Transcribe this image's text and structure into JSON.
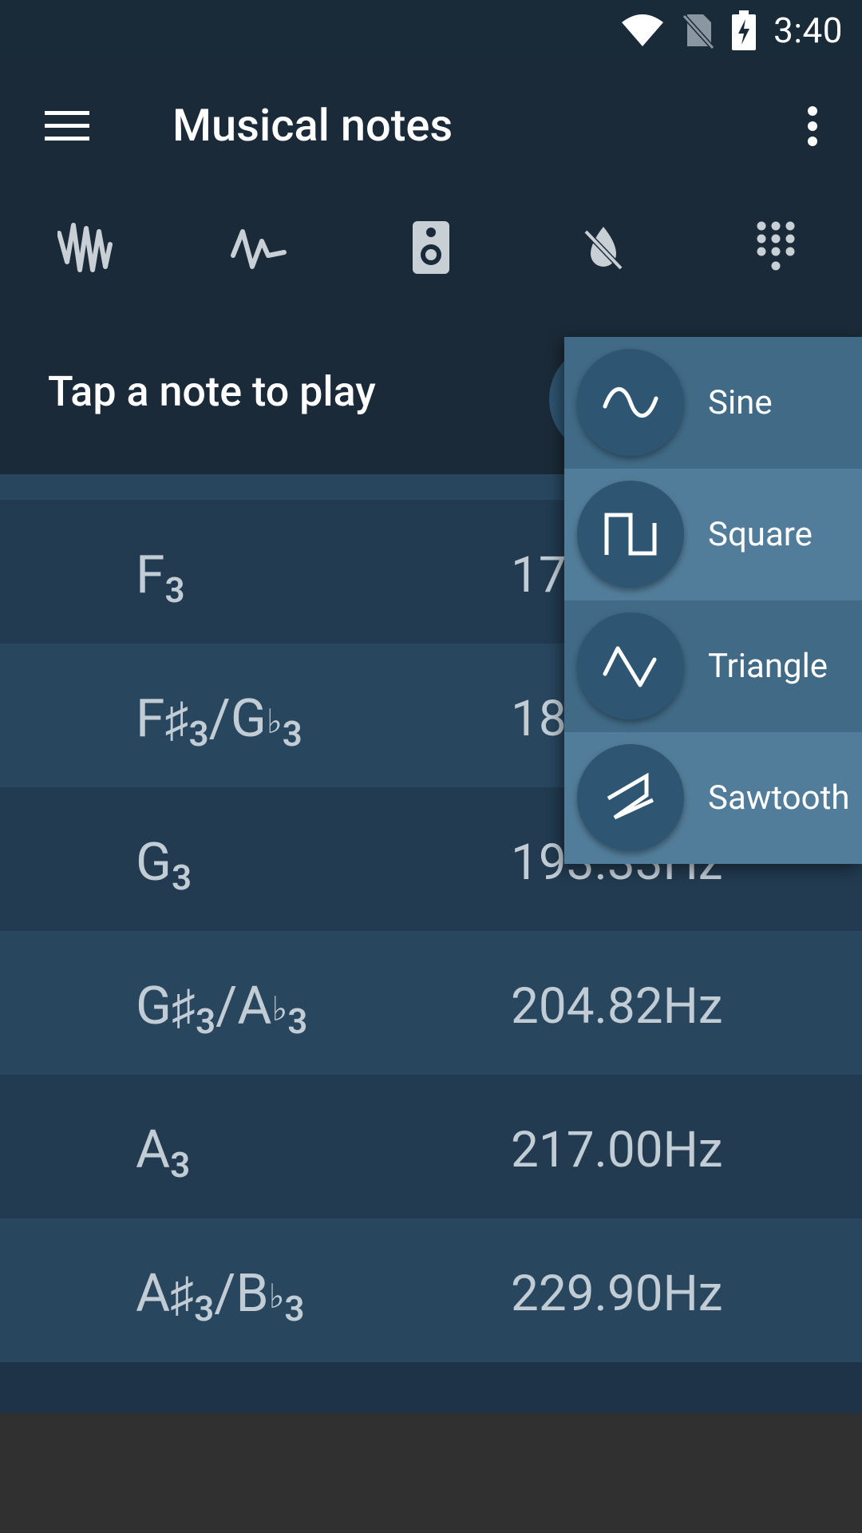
{
  "status": {
    "time": "3:40"
  },
  "app": {
    "title": "Musical notes"
  },
  "toolbar": {
    "items": [
      {
        "icon": "noise-wave-icon"
      },
      {
        "icon": "waveform-icon"
      },
      {
        "icon": "speaker-icon"
      },
      {
        "icon": "mute-drop-icon"
      },
      {
        "icon": "dialpad-icon"
      }
    ]
  },
  "tap_bar": {
    "label": "Tap a note to play"
  },
  "notes": [
    {
      "letter": "F",
      "octave": "3",
      "alt_letter": "",
      "alt_octave": "",
      "freq": "17"
    },
    {
      "letter": "F",
      "octave": "3",
      "alt_letter": "G",
      "alt_octave": "3",
      "freq": "18"
    },
    {
      "letter": "G",
      "octave": "3",
      "alt_letter": "",
      "alt_octave": "",
      "freq": "193.33Hz"
    },
    {
      "letter": "G",
      "octave": "3",
      "alt_letter": "A",
      "alt_octave": "3",
      "freq": "204.82Hz"
    },
    {
      "letter": "A",
      "octave": "3",
      "alt_letter": "",
      "alt_octave": "",
      "freq": "217.00Hz"
    },
    {
      "letter": "A",
      "octave": "3",
      "alt_letter": "B",
      "alt_octave": "3",
      "freq": "229.90Hz"
    }
  ],
  "symbols": {
    "sharp": "♯",
    "flat": "♭",
    "slash": "/"
  },
  "wave_menu": {
    "items": [
      {
        "label": "Sine",
        "icon": "sine-wave-icon"
      },
      {
        "label": "Square",
        "icon": "square-wave-icon"
      },
      {
        "label": "Triangle",
        "icon": "triangle-wave-icon"
      },
      {
        "label": "Sawtooth",
        "icon": "sawtooth-wave-icon"
      }
    ]
  },
  "colors": {
    "app_bar": "#1b2a38",
    "row_dark": "#223b50",
    "row_light": "#28465e",
    "menu_item": "#406a86",
    "menu_item_alt": "#527d9a",
    "icon_circle": "#2e5673"
  }
}
